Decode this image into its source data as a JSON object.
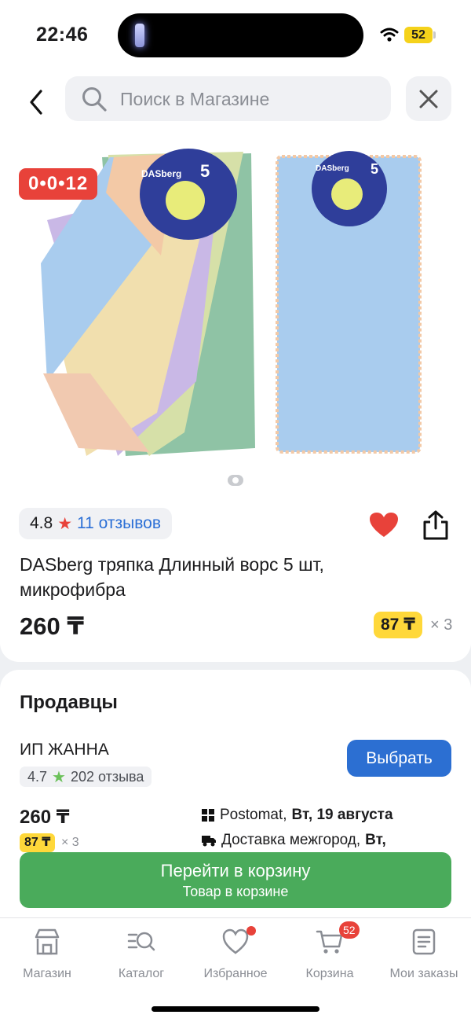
{
  "status_bar": {
    "time": "22:46",
    "battery": "52"
  },
  "header": {
    "search_placeholder": "Поиск в Магазине"
  },
  "product": {
    "timer": "0•0•12",
    "rating": "4.8",
    "reviews": "11 отзывов",
    "title": "DASberg тряпка Длинный ворс 5 шт, микрофибра",
    "price": "260 ₸",
    "installment": "87 ₸",
    "installment_mult": "× 3",
    "image_text": {
      "brand": "DASberg",
      "count": "5"
    },
    "liked": true
  },
  "sellers": {
    "title": "Продавцы",
    "seller_name": "ИП ЖАННА",
    "seller_rating": "4.7",
    "seller_reviews": "202 отзыва",
    "choose_label": "Выбрать",
    "price": "260 ₸",
    "installment": "87 ₸",
    "installment_mult": "× 3",
    "delivery1_prefix": "Postomat,",
    "delivery1_date": "Вт, 19 августа",
    "delivery2_prefix": "Доставка межгород,",
    "delivery2_date": "Вт,"
  },
  "cart_button": {
    "line1": "Перейти в корзину",
    "line2": "Товар в корзине"
  },
  "tabs": [
    {
      "label": "Магазин",
      "icon": "store-icon"
    },
    {
      "label": "Каталог",
      "icon": "catalog-search-icon"
    },
    {
      "label": "Избранное",
      "icon": "heart-icon"
    },
    {
      "label": "Корзина",
      "icon": "cart-icon",
      "badge": "52"
    },
    {
      "label": "Мои заказы",
      "icon": "orders-icon"
    }
  ],
  "colors": {
    "accent_blue": "#2c6fd2",
    "cart_green": "#4aab5b",
    "sale_red": "#e8423a",
    "installment_yellow": "#ffd83a"
  }
}
